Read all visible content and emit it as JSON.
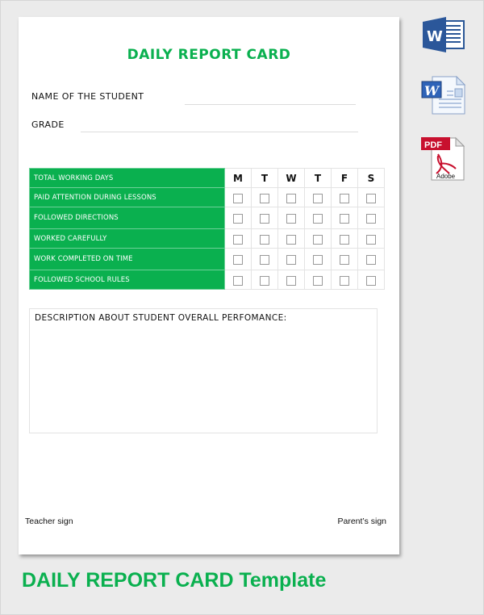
{
  "document": {
    "title": "DAILY REPORT CARD",
    "fields": [
      {
        "label": "NAME OF THE STUDENT",
        "value": ""
      },
      {
        "label": "GRADE",
        "value": ""
      }
    ],
    "table": {
      "header_label": "TOTAL WORKING DAYS",
      "days": [
        "M",
        "T",
        "W",
        "T",
        "F",
        "S"
      ],
      "rows": [
        {
          "label": "PAID ATTENTION DURING LESSONS",
          "checked": [
            false,
            false,
            false,
            false,
            false,
            false
          ]
        },
        {
          "label": "FOLLOWED DIRECTIONS",
          "checked": [
            false,
            false,
            false,
            false,
            false,
            false
          ]
        },
        {
          "label": "WORKED CAREFULLY",
          "checked": [
            false,
            false,
            false,
            false,
            false,
            false
          ]
        },
        {
          "label": "WORK COMPLETED ON TIME",
          "checked": [
            false,
            false,
            false,
            false,
            false,
            false
          ]
        },
        {
          "label": "FOLLOWED SCHOOL RULES",
          "checked": [
            false,
            false,
            false,
            false,
            false,
            false
          ]
        }
      ]
    },
    "description_label": "DESCRIPTION ABOUT STUDENT OVERALL PERFOMANCE:",
    "teacher_sign": "Teacher sign",
    "parent_sign": "Parent’s sign"
  },
  "footer_title": "DAILY REPORT CARD Template",
  "format_icons": [
    {
      "name": "word-2013-icon",
      "label": "W"
    },
    {
      "name": "word-doc-icon",
      "label": "W"
    },
    {
      "name": "pdf-icon",
      "label": "PDF",
      "sublabel": "Adobe"
    }
  ],
  "colors": {
    "accent": "#0ab04f",
    "background": "#ebebeb"
  }
}
